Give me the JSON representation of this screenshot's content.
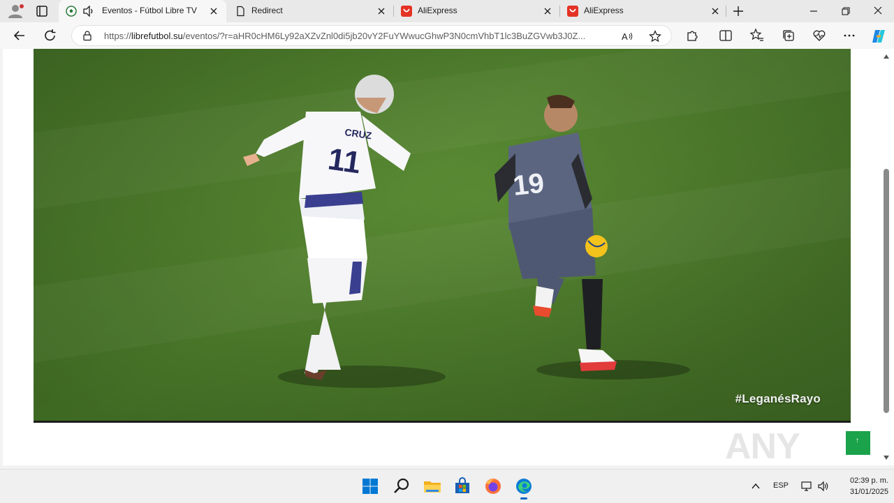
{
  "browser": {
    "tabs": [
      {
        "title": "Eventos - Fútbol Libre TV",
        "active": true,
        "favicon": "soccer-ball-icon",
        "audio": true
      },
      {
        "title": "Redirect",
        "active": false,
        "favicon": "page-icon"
      },
      {
        "title": "AliExpress",
        "active": false,
        "favicon": "aliexpress-icon"
      },
      {
        "title": "AliExpress",
        "active": false,
        "favicon": "aliexpress-icon"
      }
    ],
    "address": {
      "url_prefix": "https://",
      "url_domain": "librefutbol.su",
      "url_rest": "/eventos/?r=aHR0cHM6Ly92aXZvZnl0di5jb20vY2FuYWwucGhwP3N0cmVhbT1lc3BuZGVwb3J0Z..."
    },
    "accent_color": "#0067c0"
  },
  "page": {
    "video_overlay_hashtag": "#LeganésRayo",
    "player_left_shirt_name": "CRUZ",
    "player_left_number": "11",
    "player_right_number": "19",
    "scroll_top_symbol": "↑",
    "watermark": "ANY RUN",
    "pitch_color": "#4f7d2d"
  },
  "taskbar": {
    "apps": [
      "windows-start-icon",
      "search-icon",
      "file-explorer-icon",
      "microsoft-store-icon",
      "firefox-icon",
      "edge-icon"
    ],
    "language": "ESP",
    "time": "02:39 p. m.",
    "date": "31/01/2025"
  }
}
